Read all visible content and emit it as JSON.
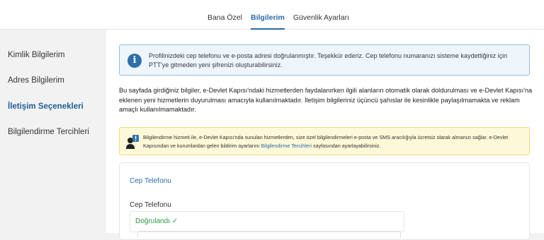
{
  "tabs": [
    {
      "label": "Bana Özel"
    },
    {
      "label": "Bilgilerim"
    },
    {
      "label": "Güvenlik Ayarları"
    }
  ],
  "sidebar": {
    "items": [
      {
        "label": "Kimlik Bilgilerim"
      },
      {
        "label": "Adres Bilgilerim"
      },
      {
        "label": "İletişim Seçenekleri"
      },
      {
        "label": "Bilgilendirme Tercihleri"
      }
    ]
  },
  "info": {
    "icon": "info-icon",
    "text": "Profilinizdeki cep telefonu ve e-posta adresi doğrulanmıştır. Teşekkür ederiz. Cep telefonu numaranızı sisteme kaydettiğiniz için PTT'ye gitmeden yeni şifrenizi oluşturabilirsiniz."
  },
  "description": "Bu sayfada girdiğiniz bilgiler, e-Devlet Kapısı'ndaki hizmetlerden faydalanırken ilgili alanların otomatik olarak doldurulması ve e-Devlet Kapısı'na eklenen yeni hizmetlerin duyurulması amacıyla kullanılmaktadır. İletişim bilgileriniz üçüncü şahıslar ile kesinlikle paylaşılmamakta ve reklam amaçlı kullanılmamaktadır.",
  "warning": {
    "icon": "user-alert-icon",
    "text_before": "Bilgilendirme hizmeti ile, e-Devlet Kapısı'nda sunulan hizmetlerden, size özel bilgilendirmeleri e-posta ve SMS aracılığıyla ücretsiz olarak almanızı sağlar. e-Devlet Kapısından ve kurumlardan gelen bildirim ayarlarını ",
    "link": "Bilgilendirme Tercihleri",
    "text_after": " sayfasından ayarlayabilirsiniz."
  },
  "phone_card": {
    "title": "Cep Telefonu",
    "field_label": "Cep Telefonu",
    "status": "Doğrulandı ✓"
  },
  "colors": {
    "accent": "#2a6aa6",
    "verified": "#2e9a3f",
    "info_bg": "#eef5fb",
    "warning_bg": "#fdf8d8"
  }
}
